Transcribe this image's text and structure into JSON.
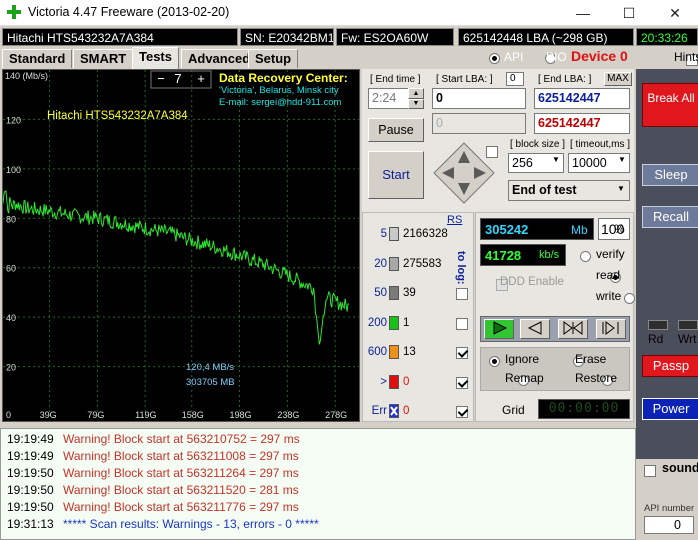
{
  "window": {
    "title": "Victoria 4.47  Freeware (2013-02-20)",
    "minimize": "—",
    "maximize": "☐",
    "close": "✕"
  },
  "infobar": {
    "drive": "Hitachi HTS543232A7A384",
    "serial": "SN: E20342BM1RXJXP",
    "firmware": "Fw: ES2OA60W",
    "lba": "625142448 LBA (~298 GB)",
    "time": "20:33:26"
  },
  "tabs": [
    "Standard",
    "SMART",
    "Tests",
    "Advanced",
    "Setup"
  ],
  "mode": {
    "api": "API",
    "pio": "PIO",
    "device": "Device 0",
    "hints": "Hints"
  },
  "graph": {
    "ytop": "140 (Mb/s)",
    "y_ticks": [
      "120",
      "100",
      "80",
      "60",
      "40",
      "20"
    ],
    "x_ticks": [
      "0",
      "39G",
      "79G",
      "119G",
      "158G",
      "198G",
      "238G",
      "278G"
    ],
    "drive_label": "Hitachi HTS543232A7A384",
    "speed": "120,4 MB/s",
    "position": "303705 MB",
    "spin_minus": "−",
    "spin_value": "7",
    "spin_plus": "+",
    "drc_title": "Data Recovery Center:",
    "drc_line2": "'Victoria', Belarus, Minsk city",
    "drc_line3": "E-mail: sergei@hdd-911.com",
    "color_line": "#2ee62e",
    "color_grid": "#1d6b1d"
  },
  "chart_data": {
    "type": "line",
    "title": "",
    "ylabel": "140 (Mb/s)",
    "xlabel": "",
    "ylim": [
      0,
      140
    ],
    "x_ticks": [
      "0",
      "39G",
      "79G",
      "119G",
      "158G",
      "198G",
      "238G",
      "278G"
    ],
    "series": [
      {
        "x": [
          0,
          2,
          4,
          6,
          8,
          10,
          20,
          39,
          60,
          79,
          100,
          119,
          140,
          158,
          180,
          198,
          220,
          238,
          250,
          260,
          265,
          270,
          275,
          280,
          290
        ],
        "y": [
          86,
          95,
          83,
          87,
          85,
          86,
          84,
          83,
          81,
          80,
          78,
          76,
          74,
          71,
          68,
          65,
          61,
          57,
          54,
          52,
          28,
          48,
          47,
          46,
          44
        ]
      }
    ]
  },
  "controls": {
    "end_time_label": "[ End time ]",
    "end_time": "2:24",
    "start_lba_label": "[ Start LBA: ]",
    "start_lba_box": "0",
    "start_lba": "0",
    "end_lba_label": "[ End LBA: ]",
    "max": "MAX",
    "end_lba": "625142447",
    "end_lba_red": "625142447",
    "pause": "Pause",
    "start": "Start",
    "block_size_label": "[ block size ]",
    "block_size": "256",
    "timeout_label": "[ timeout,ms ]",
    "timeout": "10000",
    "end_mode": "End of test"
  },
  "legend": {
    "rs": "RS",
    "to_log": "to log:",
    "rows": [
      {
        "label": "5",
        "count": "2166328",
        "color": "#c8c8c8",
        "checked": false
      },
      {
        "label": "20",
        "count": "275583",
        "color": "#a8a8a8",
        "checked": false
      },
      {
        "label": "50",
        "count": "39",
        "color": "#7a7a7a",
        "checked": false
      },
      {
        "label": "200",
        "count": "1",
        "color": "#19c219",
        "checked": false
      },
      {
        "label": "600",
        "count": "13",
        "color": "#f09018",
        "checked": true
      },
      {
        "label": ">",
        "count": "0",
        "color": "#e01010",
        "checked": true
      },
      {
        "label": "Err",
        "count": "0",
        "color": "#2030d8",
        "checked": true
      }
    ]
  },
  "stats": {
    "mb": "305242",
    "mb_unit": "Mb",
    "percent": "100",
    "percent_unit": "%",
    "kbs": "41728",
    "kbs_unit": "kb/s",
    "ddd": "DDD Enable",
    "verify": "verify",
    "read": "read",
    "write": "write"
  },
  "repair": {
    "ignore": "Ignore",
    "erase": "Erase",
    "remap": "Remap",
    "restore": "Restore",
    "grid": "Grid",
    "timer": "00:00:00"
  },
  "sidebar": {
    "break_all": "Break All",
    "sleep": "Sleep",
    "recall": "Recall",
    "rd": "Rd",
    "wrt": "Wrt",
    "passp": "Passp",
    "power": "Power",
    "sound": "sound",
    "api_number": "API number",
    "api_value": "0"
  },
  "log": [
    {
      "time": "19:19:49",
      "msg": "Warning! Block start at 563210752 = 297 ms",
      "kind": "warn"
    },
    {
      "time": "19:19:49",
      "msg": "Warning! Block start at 563211008 = 297 ms",
      "kind": "warn"
    },
    {
      "time": "19:19:50",
      "msg": "Warning! Block start at 563211264 = 297 ms",
      "kind": "warn"
    },
    {
      "time": "19:19:50",
      "msg": "Warning! Block start at 563211520 = 281 ms",
      "kind": "warn"
    },
    {
      "time": "19:19:50",
      "msg": "Warning! Block start at 563211776 = 297 ms",
      "kind": "warn"
    },
    {
      "time": "19:31:13",
      "msg": "***** Scan results: Warnings - 13, errors - 0 *****",
      "kind": "info"
    }
  ]
}
